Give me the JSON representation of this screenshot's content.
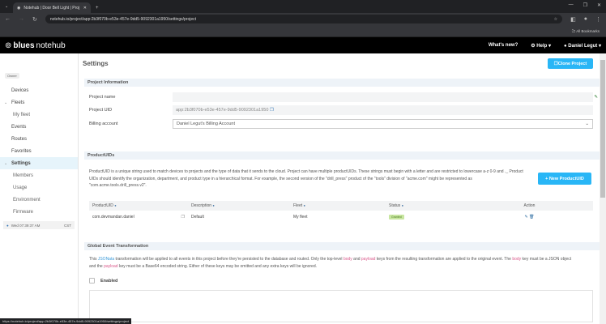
{
  "browser": {
    "tab_title": "Notehub | Door Bell Light | Proj",
    "url": "notehub.io/project/app:2b3f070b-e53e-457e-9dd5-9092301a1950/settings/project",
    "bookmarks": "All Bookmarks",
    "status_url": "https://notehub.io/project/app:2b3f070b-e53e-457e-9dd5-9092301a1950/settings/project"
  },
  "header": {
    "logo_bold": "blues",
    "logo_rest": "notehub",
    "whats_new": "What's new?",
    "help": "Help",
    "user": "Daniel Legut"
  },
  "sidebar": {
    "role": "Owner",
    "items": [
      {
        "label": "Devices"
      },
      {
        "label": "Fleets"
      },
      {
        "label": "My fleet"
      },
      {
        "label": "Events"
      },
      {
        "label": "Routes"
      },
      {
        "label": "Favorites"
      },
      {
        "label": "Settings"
      },
      {
        "label": "Members"
      },
      {
        "label": "Usage"
      },
      {
        "label": "Environment"
      },
      {
        "label": "Firmware"
      }
    ],
    "clock": "Wed 07:39:37 AM",
    "tz": "CST"
  },
  "page": {
    "title": "Settings",
    "clone_button": "Clone Project"
  },
  "project_info": {
    "header": "Project Information",
    "name_label": "Project name",
    "name_value": "",
    "uid_label": "Project UID",
    "uid_value": "app:2b3f070b-e53e-457e-9dd5-9092301a1950",
    "billing_label": "Billing account",
    "billing_value": "Daniel Legut's Billing Account"
  },
  "product_uids": {
    "header": "ProductUIDs",
    "description": "ProductUID is a unique string used to match devices to projects and the type of data that it sends to the cloud. Project can have multiple productUIDs. These strings must begin with a letter and are restricted to lowercase a-z 0-9 and ._ Product UIDs should identify the organization, department, and product type in a hierarchical format. For example, the second version of the \"drill_press\" product of the \"tools\" division of \"acme.com\" might be represented as \"com.acme.tools.drill_press.v2\".",
    "new_button": "+ New ProductUID",
    "columns": [
      "ProductUID",
      "Description",
      "Fleet",
      "Status",
      "Action"
    ],
    "rows": [
      {
        "uid": "com.devmandan.daniel",
        "description": "Default",
        "fleet": "My fleet",
        "status": "Granted"
      }
    ]
  },
  "transform": {
    "header": "Global Event Transformation",
    "t1": "This ",
    "jsonata": "JSONata",
    "t2": " transformation will be applied to all events in this project before they're persisted to the database and routed. Only the top-level ",
    "body": "body",
    "t3": " and ",
    "payload": "payload",
    "t4": " keys from the resulting transformation are applied to the original event. The ",
    "t5": " key must be a JSON object and the ",
    "t6": " key must be a Base64 encoded string. Either of these keys may be omitted and any extra keys will be ignored.",
    "enabled_label": "Enabled"
  }
}
